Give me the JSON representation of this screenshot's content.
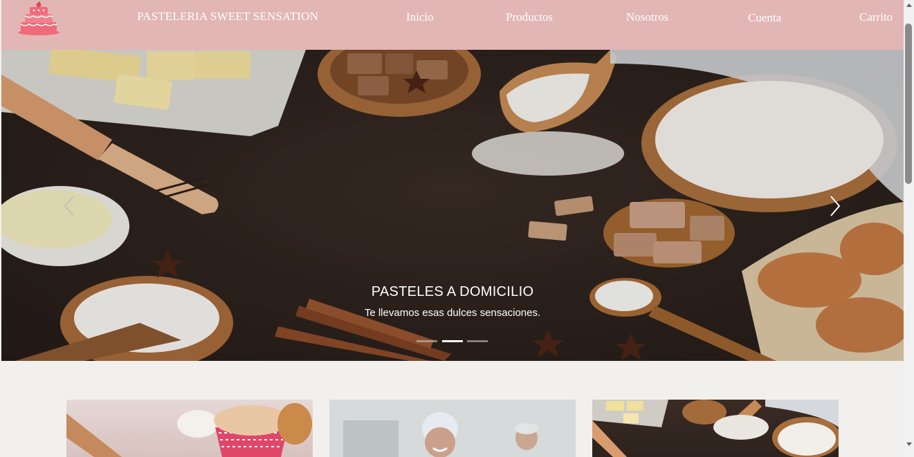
{
  "navbar": {
    "brand": "PASTELERIA SWEET SENSATION",
    "logo_icon": "cake-icon",
    "links": [
      "Inicio",
      "Productos",
      "Nosotros",
      "Cuenta",
      "Carrito"
    ]
  },
  "hero": {
    "title": "PASTELES A DOMICILIO",
    "subtitle": "Te llevamos esas dulces sensaciones.",
    "prev_icon": "chevron-left-icon",
    "next_icon": "chevron-right-icon",
    "slide_count": 3,
    "active_slide": 2
  },
  "colors": {
    "navbar_bg": "#e2b6b5",
    "page_bg": "#f1f0ed",
    "logo_pink": "#f06a7a"
  }
}
